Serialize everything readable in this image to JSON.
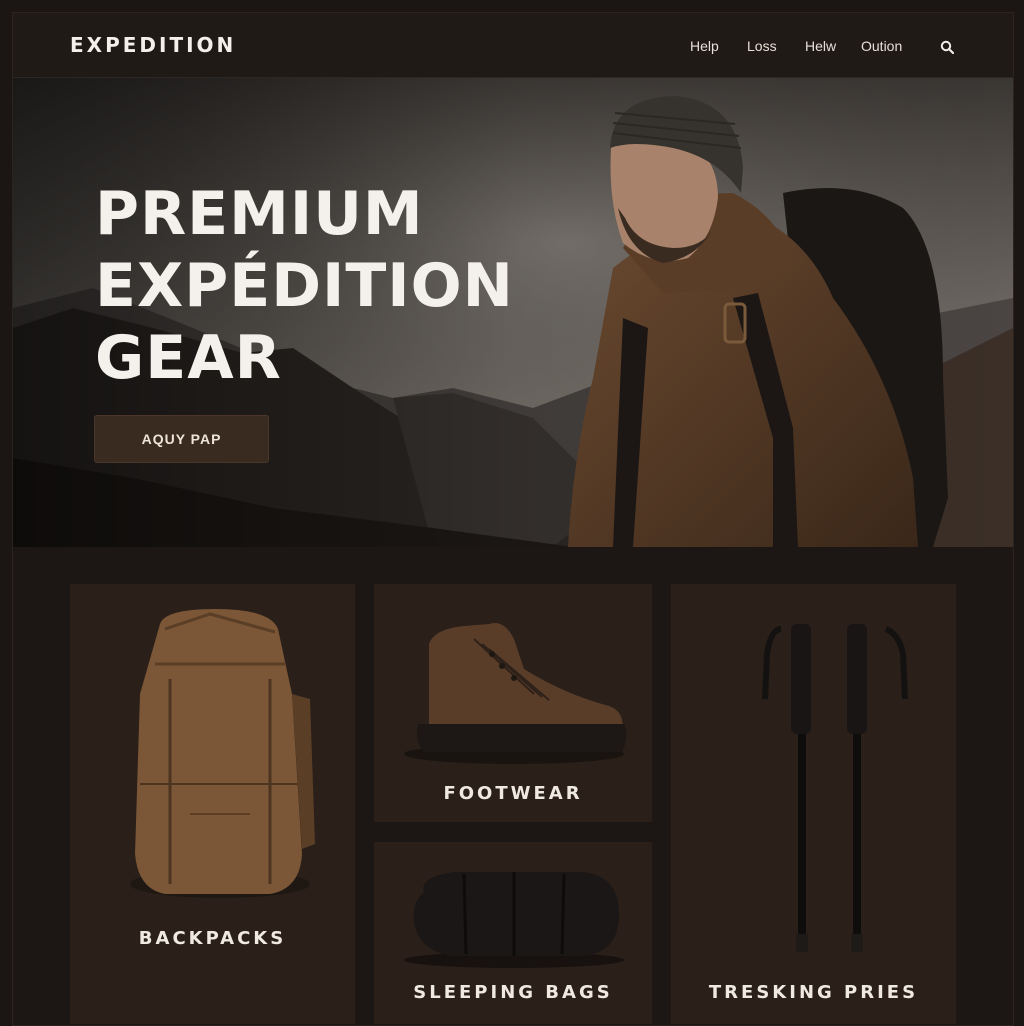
{
  "brand": "EXPEDITION",
  "nav": {
    "links": [
      "Help",
      "Loss",
      "Helw",
      "Oution"
    ]
  },
  "icons": {
    "search": "search-icon"
  },
  "hero": {
    "title_lines": [
      "PREMIUM",
      "EXPÉDITION",
      "GEAR"
    ],
    "cta_label": "AQUY PAP"
  },
  "categories": [
    {
      "label": "BACKPACKS"
    },
    {
      "label": "FOOTWEAR"
    },
    {
      "label": "SLEEPING BAGS"
    },
    {
      "label": "TRESKING PRIES"
    }
  ],
  "colors": {
    "background": "#1c1714",
    "card": "#2a1f19",
    "accent": "#3a2b20",
    "text": "#f4f1ec"
  }
}
